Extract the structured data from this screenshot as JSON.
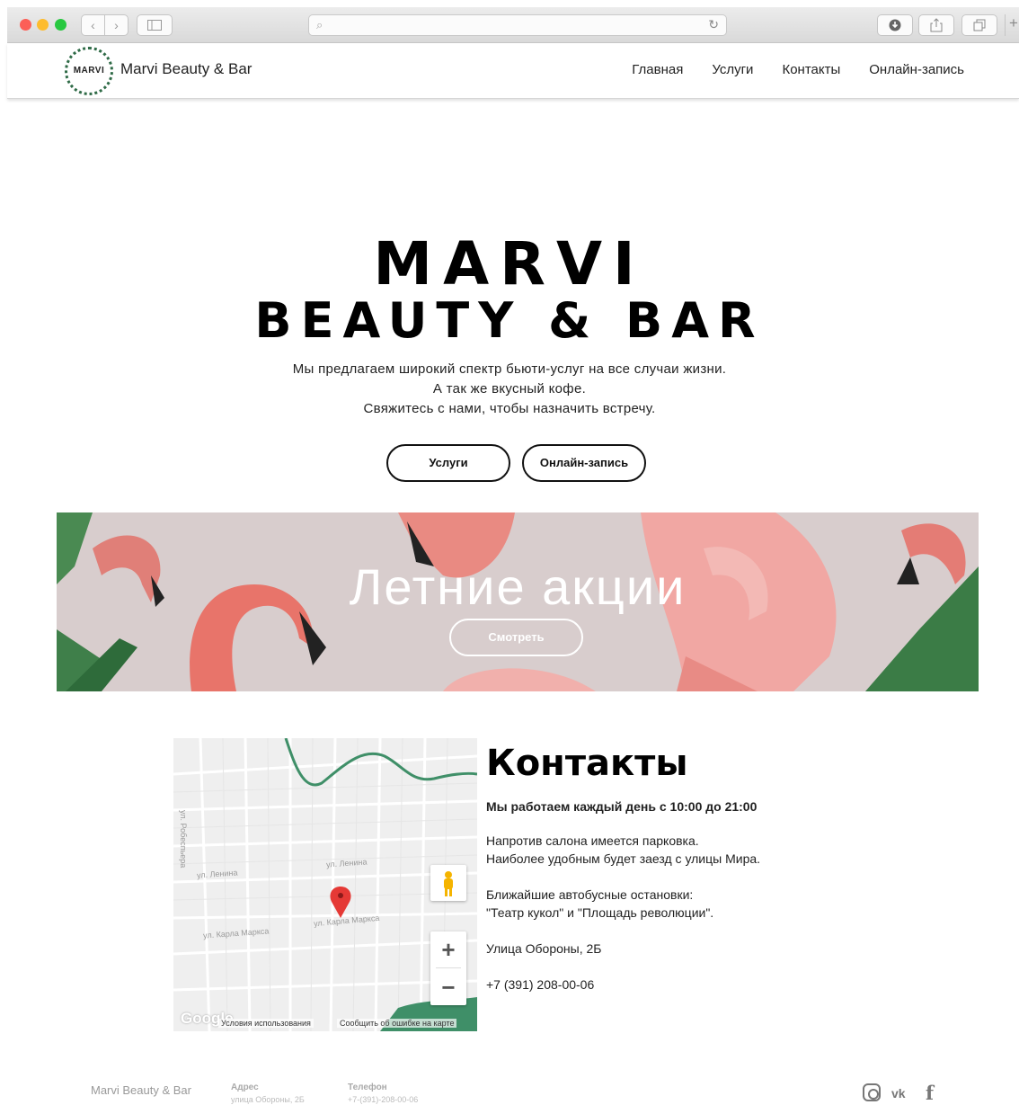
{
  "browser": {
    "back": "‹",
    "forward": "›",
    "search_icon": "⌕",
    "reload_icon": "↻",
    "new_tab": "+"
  },
  "header": {
    "logo_text": "MARVI",
    "brand": "Marvi Beauty & Bar",
    "menu": [
      "Главная",
      "Услуги",
      "Контакты",
      "Онлайн-запись"
    ]
  },
  "hero": {
    "title_line1": "MARVI",
    "title_line2": "BEAUTY & BAR",
    "lines": [
      "Мы предлагаем широкий спектр бьюти-услуг на все случаи жизни.",
      "А так же вкусный кофе.",
      "Свяжитесь с нами, чтобы назначить встречу."
    ],
    "button_services": "Услуги",
    "button_booking": "Онлайн-запись"
  },
  "banner": {
    "title": "Летние акции",
    "button": "Смотреть"
  },
  "map": {
    "streets": [
      "ул. Робеспьера",
      "ул. Ленина",
      "ул. Ленина",
      "ул. Карла Маркса",
      "ул. Карла Маркса"
    ],
    "google": "Google",
    "terms": "Условия использования",
    "report": "Сообщить об ошибке на карте",
    "zoom_in": "+",
    "zoom_out": "−"
  },
  "contacts": {
    "title": "Контакты",
    "hours": "Мы работаем каждый день с 10:00 до 21:00",
    "lines": [
      "Напротив салона имеется парковка.",
      "Наиболее удобным будет заезд с улицы Мира.",
      "Ближайшие автобусные остановки:",
      "\"Театр кукол\" и \"Площадь революции\".",
      "Улица Обороны, 2Б",
      "+7 (391) 208-00-06"
    ]
  },
  "footer": {
    "brand": "Marvi Beauty & Bar",
    "address_label": "Адрес",
    "address_value": "улица Обороны, 2Б",
    "phone_label": "Телефон",
    "phone_value": "+7-(391)-208-00-06",
    "vk": "vk",
    "fb": "f"
  },
  "colors": {
    "banner_bg": "#d8cdcd",
    "map_river": "#3f8f68",
    "map_pin": "#e53935"
  }
}
